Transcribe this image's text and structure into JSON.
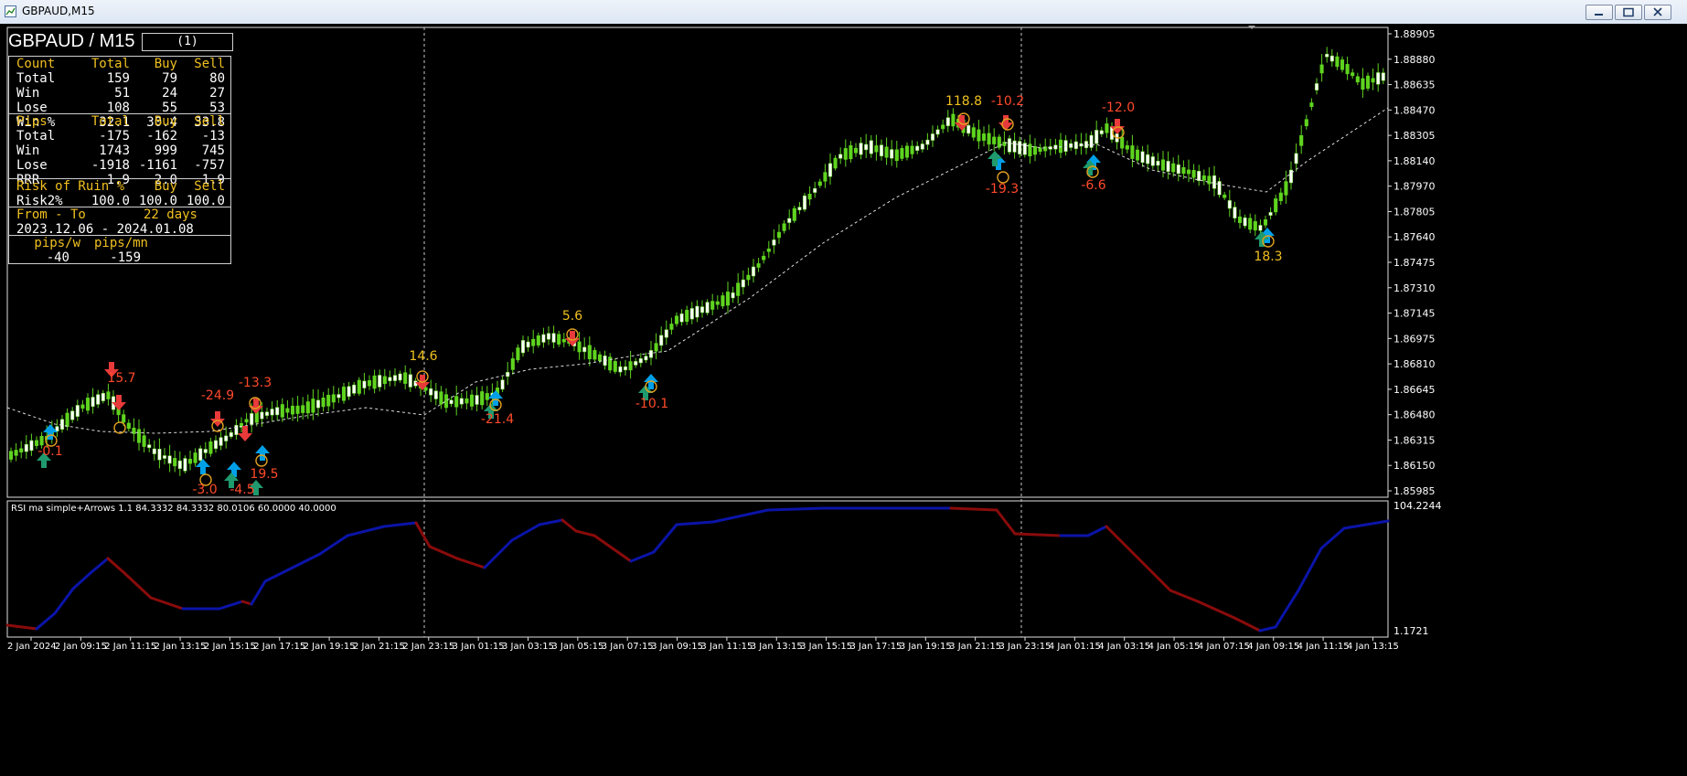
{
  "window": {
    "title": "GBPAUD,M15"
  },
  "chart": {
    "symbol_label": "GBPAUD / M15",
    "cycle_box": "(1)",
    "y_axis_ticks": [
      "1.88905",
      "1.88880",
      "1.88635",
      "1.88470",
      "1.88305",
      "1.88140",
      "1.87970",
      "1.87805",
      "1.87640",
      "1.87475",
      "1.87310",
      "1.87145",
      "1.86975",
      "1.86810",
      "1.86645",
      "1.86480",
      "1.86315",
      "1.86150",
      "1.85985"
    ],
    "x_axis_ticks": [
      "2 Jan 2024",
      "2 Jan 09:15",
      "2 Jan 11:15",
      "2 Jan 13:15",
      "2 Jan 15:15",
      "2 Jan 17:15",
      "2 Jan 19:15",
      "2 Jan 21:15",
      "2 Jan 23:15",
      "3 Jan 01:15",
      "3 Jan 03:15",
      "3 Jan 05:15",
      "3 Jan 07:15",
      "3 Jan 09:15",
      "3 Jan 11:15",
      "3 Jan 13:15",
      "3 Jan 15:15",
      "3 Jan 17:15",
      "3 Jan 19:15",
      "3 Jan 21:15",
      "3 Jan 23:15",
      "4 Jan 01:15",
      "4 Jan 03:15",
      "4 Jan 05:15",
      "4 Jan 07:15",
      "4 Jan 09:15",
      "4 Jan 11:15",
      "4 Jan 13:15"
    ],
    "trade_labels": [
      {
        "text": "-0.1",
        "color": "#ff4a2a"
      },
      {
        "text": "15.7",
        "color": "#ff4a2a"
      },
      {
        "text": "-24.9",
        "color": "#ff4a2a"
      },
      {
        "text": "-13.3",
        "color": "#ff4a2a"
      },
      {
        "text": "-3.0",
        "color": "#ff4a2a"
      },
      {
        "text": "-4.5",
        "color": "#ff4a2a"
      },
      {
        "text": "19.5",
        "color": "#ff4a2a"
      },
      {
        "text": "14.6",
        "color": "#f0c020"
      },
      {
        "text": "-21.4",
        "color": "#ff4a2a"
      },
      {
        "text": "5.6",
        "color": "#f0c020"
      },
      {
        "text": "-10.1",
        "color": "#ff4a2a"
      },
      {
        "text": "118.8",
        "color": "#f0c020"
      },
      {
        "text": "-10.2",
        "color": "#ff4a2a"
      },
      {
        "text": "-19.3",
        "color": "#ff4a2a"
      },
      {
        "text": "-12.0",
        "color": "#ff4a2a"
      },
      {
        "text": "-6.6",
        "color": "#ff4a2a"
      },
      {
        "text": "18.3",
        "color": "#f0c020"
      }
    ]
  },
  "stats": {
    "count": {
      "header": [
        "Count",
        "Total",
        "Buy",
        "Sell"
      ],
      "rows": [
        [
          "Total",
          "159",
          "79",
          "80"
        ],
        [
          "Win",
          "51",
          "24",
          "27"
        ],
        [
          "Lose",
          "108",
          "55",
          "53"
        ],
        [
          "Win %",
          "32.1",
          "30.4",
          "33.8"
        ]
      ]
    },
    "pips": {
      "header": [
        "Pips",
        "Total",
        "Buy",
        "Sell"
      ],
      "rows": [
        [
          "Total",
          "-175",
          "-162",
          "-13"
        ],
        [
          "Win",
          "1743",
          "999",
          "745"
        ],
        [
          "Lose",
          "-1918",
          "-1161",
          "-757"
        ],
        [
          "RRR",
          "1.9",
          "2.0",
          "1.9"
        ]
      ]
    },
    "ruin": {
      "header": [
        "Risk of Ruin %",
        "Buy",
        "Sell"
      ],
      "rows": [
        [
          "Risk2%",
          "100.0",
          "100.0",
          "100.0"
        ]
      ]
    },
    "range": {
      "header": "From - To",
      "days": "22 days",
      "value": "2023.12.06 - 2024.01.08"
    },
    "rate": {
      "header": [
        "pips/w",
        "pips/mn"
      ],
      "values": [
        "-40",
        "-159"
      ]
    }
  },
  "rsi": {
    "title": "RSI ma simple+Arrows 1.1 84.3332 84.3332 80.0106 60.0000 40.0000",
    "y_top": "104.2244",
    "y_bottom": "1.1721"
  },
  "colors": {
    "bull": "#5fd41f",
    "bear": "#ffffff",
    "buy_arrow": "#00a0e8",
    "sell_arrow": "#e83a3a",
    "green_arrow": "#1f9a6e",
    "rsi_up": "#0b14a8",
    "rsi_down": "#8a0b0b",
    "grid_line": "#c8c8c8",
    "ma_line": "#dcdcdc"
  }
}
